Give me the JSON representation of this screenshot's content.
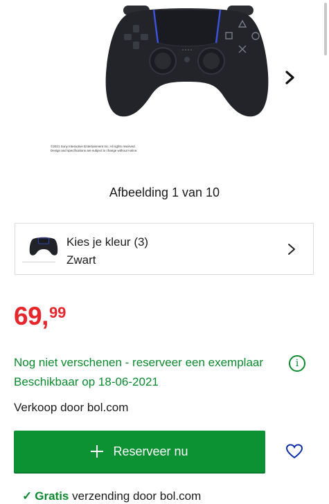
{
  "gallery": {
    "copyright_line1": "©2021 Sony Interactive Entertainment Inc. All rights reserved.",
    "copyright_line2": "Design and specifications are subject to change without notice.",
    "counter": "Afbeelding 1 van 10",
    "next_icon": "chevron-right-icon"
  },
  "color_picker": {
    "title": "Kies je kleur (3)",
    "selected": "Zwart"
  },
  "price": {
    "main": "69,",
    "cents": "99",
    "color": "#e5262a"
  },
  "availability": {
    "status": "Nog niet verschenen - reserveer een exemplaar",
    "release": "Beschikbaar op 18-06-2021",
    "seller": "Verkoop door bol.com",
    "color": "#0a8a2e"
  },
  "actions": {
    "reserve_label": "Reserveer nu",
    "wishlist_icon": "heart-icon"
  },
  "shipping": {
    "free_label": "Gratis",
    "rest": "verzending door bol.com"
  }
}
